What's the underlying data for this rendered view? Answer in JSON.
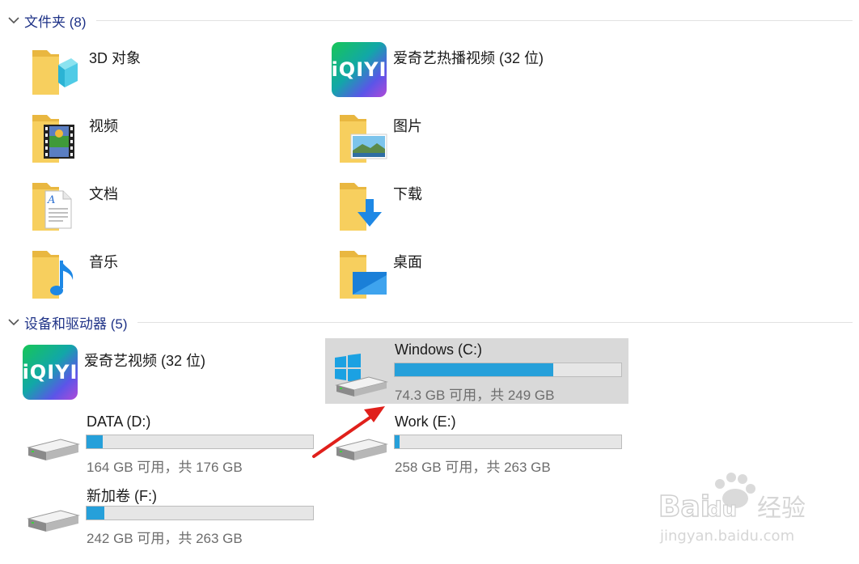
{
  "groups": {
    "folders": {
      "label": "文件夹 (8)"
    },
    "devices": {
      "label": "设备和驱动器 (5)"
    }
  },
  "folders": [
    {
      "label": "3D 对象",
      "icon": "3d-objects-folder-icon"
    },
    {
      "label": "爱奇艺热播视频 (32 位)",
      "icon": "iqiyi-icon"
    },
    {
      "label": "视频",
      "icon": "videos-folder-icon"
    },
    {
      "label": "图片",
      "icon": "pictures-folder-icon"
    },
    {
      "label": "文档",
      "icon": "documents-folder-icon"
    },
    {
      "label": "下载",
      "icon": "downloads-folder-icon"
    },
    {
      "label": "音乐",
      "icon": "music-folder-icon"
    },
    {
      "label": "桌面",
      "icon": "desktop-folder-icon"
    }
  ],
  "apps": [
    {
      "label": "爱奇艺视频 (32 位)",
      "icon": "iqiyi-icon",
      "logo_text": "iQIYI"
    }
  ],
  "drives": [
    {
      "name": "Windows (C:)",
      "status": "74.3 GB 可用，共 249 GB",
      "used_fraction": 0.7,
      "selected": true,
      "icon": "windows-drive-icon"
    },
    {
      "name": "DATA (D:)",
      "status": "164 GB 可用，共 176 GB",
      "used_fraction": 0.07,
      "selected": false,
      "icon": "hard-drive-icon"
    },
    {
      "name": "Work (E:)",
      "status": "258 GB 可用，共 263 GB",
      "used_fraction": 0.02,
      "selected": false,
      "icon": "hard-drive-icon"
    },
    {
      "name": "新加卷 (F:)",
      "status": "242 GB 可用，共 263 GB",
      "used_fraction": 0.08,
      "selected": false,
      "icon": "hard-drive-icon"
    }
  ],
  "watermark": {
    "brand": "Baidu经验",
    "url": "jingyan.baidu.com"
  },
  "colors": {
    "header_text": "#1e3287",
    "bar_fill": "#26a0da",
    "selected_bg": "#d9d9d9",
    "arrow": "#e0201b",
    "folder": "#f7cf5e"
  }
}
